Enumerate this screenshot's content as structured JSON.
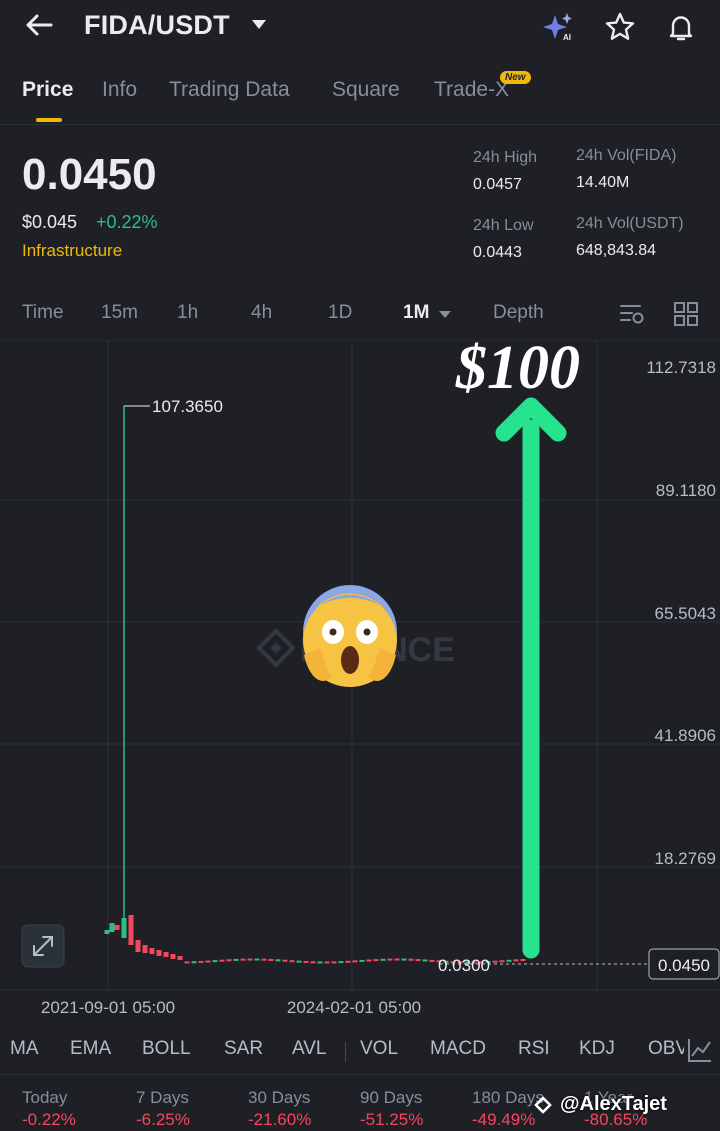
{
  "header": {
    "pair": "FIDA/USDT",
    "icons": [
      "back-arrow-icon",
      "ai-sparkle-icon",
      "star-icon",
      "bell-icon"
    ]
  },
  "tabs": [
    {
      "label": "Price",
      "active": true
    },
    {
      "label": "Info"
    },
    {
      "label": "Trading Data"
    },
    {
      "label": "Square"
    },
    {
      "label": "Trade-X",
      "badge": "New"
    }
  ],
  "ticker": {
    "last_price": "0.0450",
    "usd_price": "$0.045",
    "change": "+0.22%",
    "category": "Infrastructure",
    "high_label": "24h High",
    "high_value": "0.0457",
    "low_label": "24h Low",
    "low_value": "0.0443",
    "vol_base_label": "24h Vol(FIDA)",
    "vol_base_value": "14.40M",
    "vol_quote_label": "24h Vol(USDT)",
    "vol_quote_value": "648,843.84"
  },
  "intervals": [
    {
      "label": "Time"
    },
    {
      "label": "15m"
    },
    {
      "label": "1h"
    },
    {
      "label": "4h"
    },
    {
      "label": "1D"
    },
    {
      "label": "1M",
      "active": true
    },
    {
      "label": "Depth"
    }
  ],
  "chart_data": {
    "type": "candlestick",
    "y_ticks": [
      "112.7318",
      "89.1180",
      "65.5043",
      "41.8906",
      "18.2769"
    ],
    "x_ticks": [
      "2021-09-01 05:00",
      "2024-02-01 05:00"
    ],
    "max_label": "107.3650",
    "min_label": "0.0300",
    "current_price_label": "0.0450",
    "annotation": "$100",
    "watermark": "BINANCE",
    "colors": {
      "up": "#2ebd85",
      "down": "#f6465d",
      "arrow": "#27e28f"
    }
  },
  "indicators": [
    "MA",
    "EMA",
    "BOLL",
    "SAR",
    "AVL",
    "VOL",
    "MACD",
    "RSI",
    "KDJ",
    "OBV"
  ],
  "performance": [
    {
      "label": "Today",
      "value": "-0.22%"
    },
    {
      "label": "7 Days",
      "value": "-6.25%"
    },
    {
      "label": "30 Days",
      "value": "-21.60%"
    },
    {
      "label": "90 Days",
      "value": "-51.25%"
    },
    {
      "label": "180 Days",
      "value": "-49.49%"
    },
    {
      "label": "1 Year",
      "value": "-80.65%"
    }
  ],
  "overlay": {
    "username": "@AlexTajet"
  }
}
